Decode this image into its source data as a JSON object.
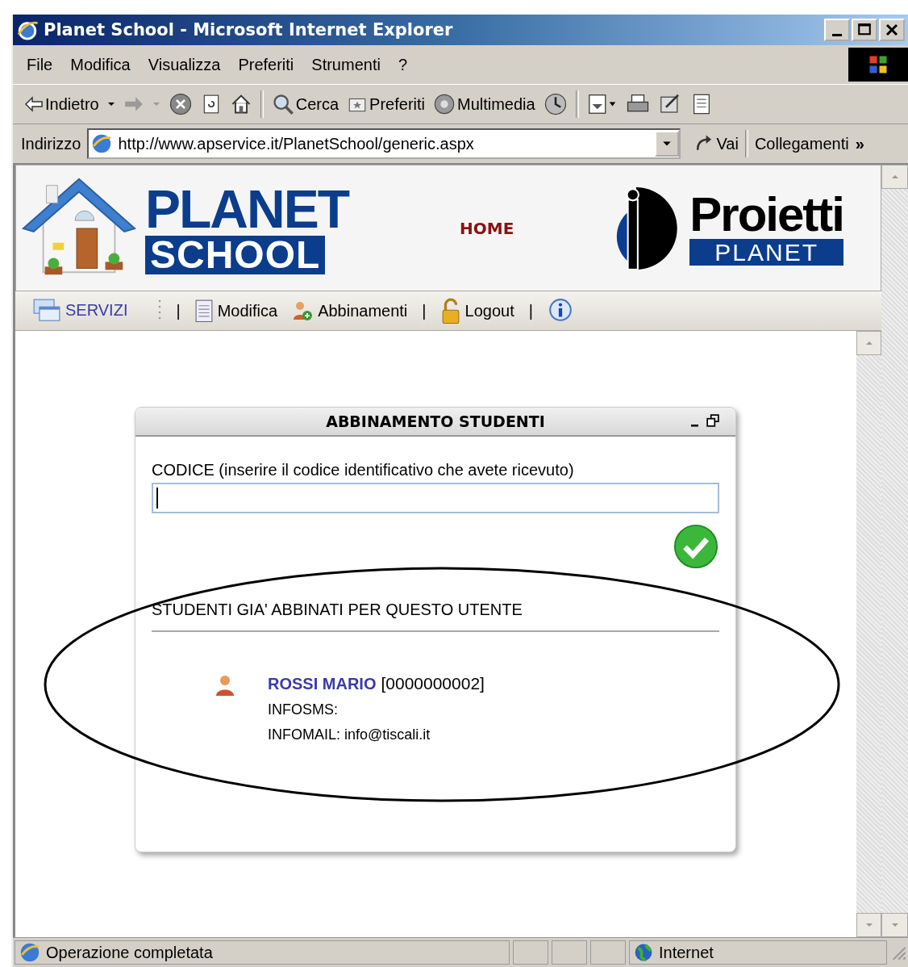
{
  "window": {
    "title": "Planet School - Microsoft Internet Explorer"
  },
  "menu": [
    "File",
    "Modifica",
    "Visualizza",
    "Preferiti",
    "Strumenti",
    "?"
  ],
  "toolbar": {
    "back": "Indietro",
    "search": "Cerca",
    "favorites": "Preferiti",
    "media": "Multimedia"
  },
  "address": {
    "label": "Indirizzo",
    "url": "http://www.apservice.it/PlanetSchool/generic.aspx",
    "go": "Vai",
    "links": "Collegamenti",
    "more": "»"
  },
  "site": {
    "logo_top": "PLANET",
    "logo_bottom": "SCHOOL",
    "home": "HOME",
    "brand": "Proietti",
    "brand_sub": "PLANET"
  },
  "nav": [
    {
      "kind": "menu",
      "label": "SERVIZI"
    },
    {
      "kind": "grip"
    },
    {
      "kind": "sep",
      "label": "|"
    },
    {
      "kind": "edit",
      "label": "Modifica"
    },
    {
      "kind": "users",
      "label": "Abbinamenti"
    },
    {
      "kind": "sep",
      "label": "|"
    },
    {
      "kind": "lock",
      "label": "Logout"
    },
    {
      "kind": "sep",
      "label": "|"
    },
    {
      "kind": "info"
    }
  ],
  "dialog": {
    "title": "ABBINAMENTO STUDENTI",
    "field_label": "CODICE (inserire il codice identificativo che avete ricevuto)",
    "section": "STUDENTI GIA' ABBINATI PER QUESTO UTENTE",
    "students": [
      {
        "name": "ROSSI MARIO",
        "code": "[0000000002]",
        "lines": [
          "INFOSMS:",
          "INFOMAIL: info@tiscali.it"
        ]
      }
    ]
  },
  "status": {
    "text": "Operazione completata",
    "zone": "Internet"
  }
}
